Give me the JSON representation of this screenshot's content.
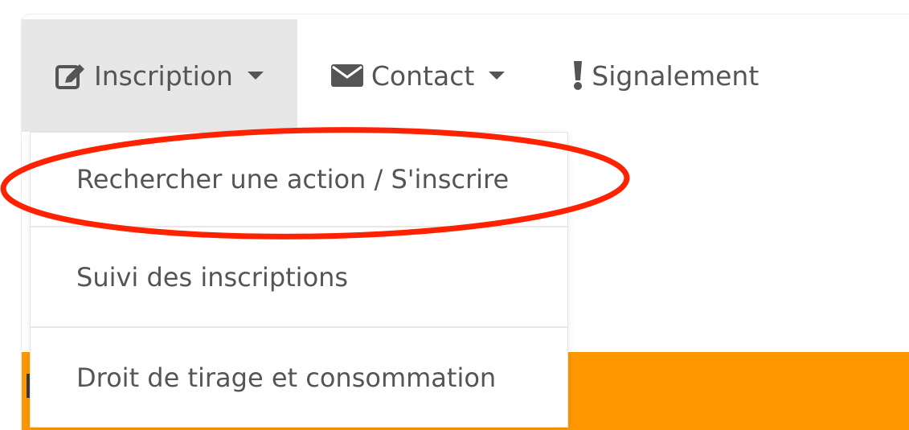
{
  "navbar": {
    "items": [
      {
        "label": "Inscription",
        "icon": "edit-icon",
        "has_caret": true,
        "active": true
      },
      {
        "label": "Contact",
        "icon": "envelope-icon",
        "has_caret": true,
        "active": false
      },
      {
        "label": "Signalement",
        "icon": "exclamation-icon",
        "has_caret": false,
        "active": false
      }
    ]
  },
  "dropdown": {
    "items": [
      {
        "label": "Rechercher une action / S'inscrire",
        "highlighted": true
      },
      {
        "label": "Suivi des inscriptions"
      },
      {
        "label": "Droit de tirage et consommation"
      }
    ]
  },
  "colors": {
    "accent_band": "#ff9800",
    "highlight_ellipse": "#ff2200",
    "active_tab_bg": "#e7e7e7",
    "text": "#555555"
  }
}
